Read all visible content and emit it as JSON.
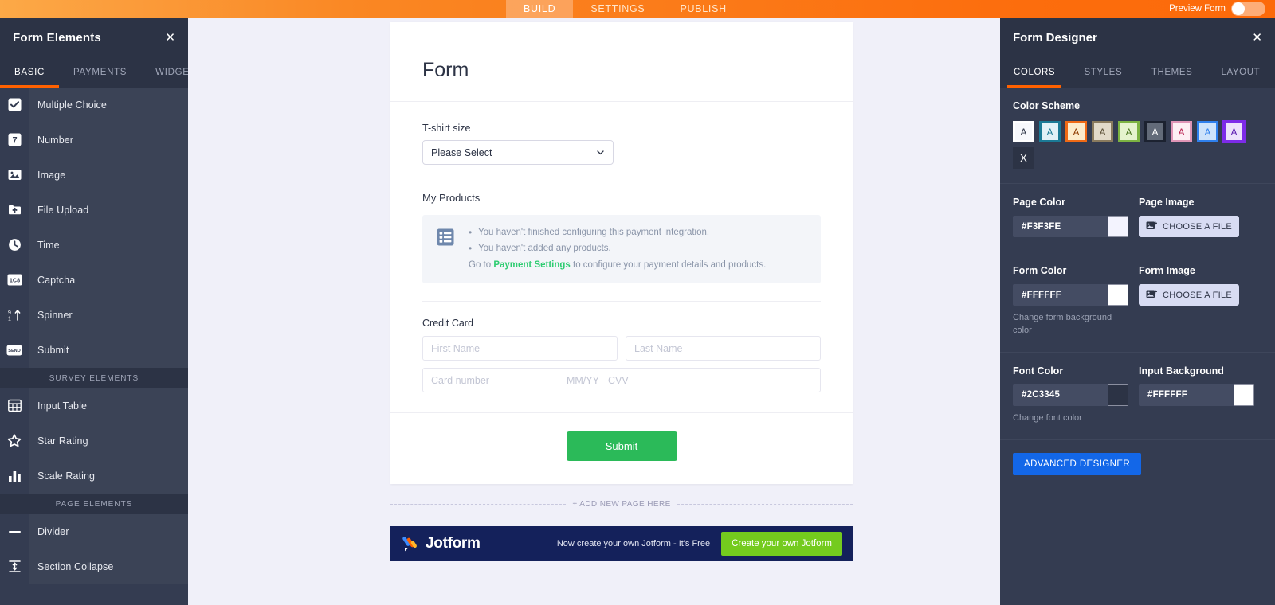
{
  "topbar": {
    "tabs": [
      {
        "label": "BUILD",
        "active": true
      },
      {
        "label": "SETTINGS",
        "active": false
      },
      {
        "label": "PUBLISH",
        "active": false
      }
    ],
    "preview_label": "Preview Form"
  },
  "left_panel": {
    "title": "Form Elements",
    "close_icon": "close-icon",
    "tabs": [
      {
        "label": "BASIC",
        "active": true
      },
      {
        "label": "PAYMENTS",
        "active": false
      },
      {
        "label": "WIDGETS",
        "active": false
      }
    ],
    "items": [
      {
        "label": "Multiple Choice",
        "icon": "checkbox-icon",
        "type": "item"
      },
      {
        "label": "Number",
        "icon": "number-seven-icon",
        "type": "item"
      },
      {
        "label": "Image",
        "icon": "image-icon",
        "type": "item"
      },
      {
        "label": "File Upload",
        "icon": "file-upload-icon",
        "type": "item"
      },
      {
        "label": "Time",
        "icon": "clock-icon",
        "type": "item"
      },
      {
        "label": "Captcha",
        "icon": "captcha-icon",
        "type": "item"
      },
      {
        "label": "Spinner",
        "icon": "spinner-icon",
        "type": "item"
      },
      {
        "label": "Submit",
        "icon": "send-icon",
        "type": "item"
      },
      {
        "label": "SURVEY ELEMENTS",
        "type": "section"
      },
      {
        "label": "Input Table",
        "icon": "table-icon",
        "type": "item"
      },
      {
        "label": "Star Rating",
        "icon": "star-icon",
        "type": "item"
      },
      {
        "label": "Scale Rating",
        "icon": "bar-chart-icon",
        "type": "item"
      },
      {
        "label": "PAGE ELEMENTS",
        "type": "section"
      },
      {
        "label": "Divider",
        "icon": "divider-icon",
        "type": "item"
      },
      {
        "label": "Section Collapse",
        "icon": "collapse-icon",
        "type": "item"
      }
    ]
  },
  "form": {
    "title": "Form",
    "tshirt": {
      "label": "T-shirt size",
      "selected": "Please Select",
      "chevron_icon": "chevron-down-icon"
    },
    "products": {
      "label": "My Products",
      "icon": "payment-list-icon",
      "bullets": [
        "You haven't finished configuring this payment integration.",
        "You haven't added any products."
      ],
      "footer_before": "Go to ",
      "footer_link": "Payment Settings",
      "footer_after": " to configure your payment details and products."
    },
    "credit_card": {
      "label": "Credit Card",
      "first_name_placeholder": "First Name",
      "last_name_placeholder": "Last Name",
      "card_number_placeholder": "Card number",
      "expiry_placeholder": "MM/YY",
      "cvv_placeholder": "CVV"
    },
    "submit_label": "Submit",
    "add_new_page": "+ ADD NEW PAGE HERE"
  },
  "jotform_banner": {
    "logo_icon": "jotform-logo-icon",
    "wordmark": "Jotform",
    "tagline": "Now create your own Jotform - It's Free",
    "cta_label": "Create your own Jotform"
  },
  "right_panel": {
    "title": "Form Designer",
    "close_icon": "close-icon",
    "tabs": [
      {
        "label": "COLORS",
        "active": true
      },
      {
        "label": "STYLES",
        "active": false
      },
      {
        "label": "THEMES",
        "active": false
      },
      {
        "label": "LAYOUT",
        "active": false
      }
    ],
    "color_scheme": {
      "heading": "Color Scheme",
      "swatches": [
        {
          "letter": "A",
          "border": "#FFFFFF",
          "fill": "#F7F8FC",
          "letter_color": "#2C3345",
          "selected": false
        },
        {
          "letter": "A",
          "border": "#1B7A96",
          "fill": "#E2F1F7",
          "letter_color": "#1B7A96",
          "selected": false
        },
        {
          "letter": "A",
          "border": "#F06A15",
          "fill": "#FDECCB",
          "letter_color": "#8E3A00",
          "selected": false
        },
        {
          "letter": "A",
          "border": "#8A7B5E",
          "fill": "#E2DACA",
          "letter_color": "#5A4E36",
          "selected": false
        },
        {
          "letter": "A",
          "border": "#7CB342",
          "fill": "#E5F3CE",
          "letter_color": "#4B7720",
          "selected": false
        },
        {
          "letter": "A",
          "border": "#1C2230",
          "fill": "#636B79",
          "letter_color": "#FFFFFF",
          "selected": false
        },
        {
          "letter": "A",
          "border": "#E095B6",
          "fill": "#FDEFF3",
          "letter_color": "#B8204F",
          "selected": false
        },
        {
          "letter": "A",
          "border": "#2F80ED",
          "fill": "#CEE3FB",
          "letter_color": "#2F80ED",
          "selected": false
        },
        {
          "letter": "A",
          "border": "#7D2BE8",
          "fill": "#EDE2FC",
          "letter_color": "#5B1BB0",
          "selected": true
        },
        {
          "letter": "X",
          "border": "",
          "fill": "#2C3345",
          "letter_color": "#FFFFFF",
          "selected": false,
          "is_clear": true
        }
      ]
    },
    "page_color": {
      "label": "Page Color",
      "value": "#F3F3FE",
      "chip": "#F3F3FE"
    },
    "page_image": {
      "label": "Page Image",
      "button": "CHOOSE A FILE",
      "icon": "image-file-icon"
    },
    "form_color": {
      "label": "Form Color",
      "value": "#FFFFFF",
      "chip": "#FFFFFF",
      "hint": "Change form background color"
    },
    "form_image": {
      "label": "Form Image",
      "button": "CHOOSE A FILE",
      "icon": "image-file-icon"
    },
    "font_color": {
      "label": "Font Color",
      "value": "#2C3345",
      "chip": "#2C3345",
      "hint": "Change font color"
    },
    "input_background": {
      "label": "Input Background",
      "value": "#FFFFFF",
      "chip": "#FFFFFF"
    },
    "advanced_designer": "ADVANCED DESIGNER"
  }
}
